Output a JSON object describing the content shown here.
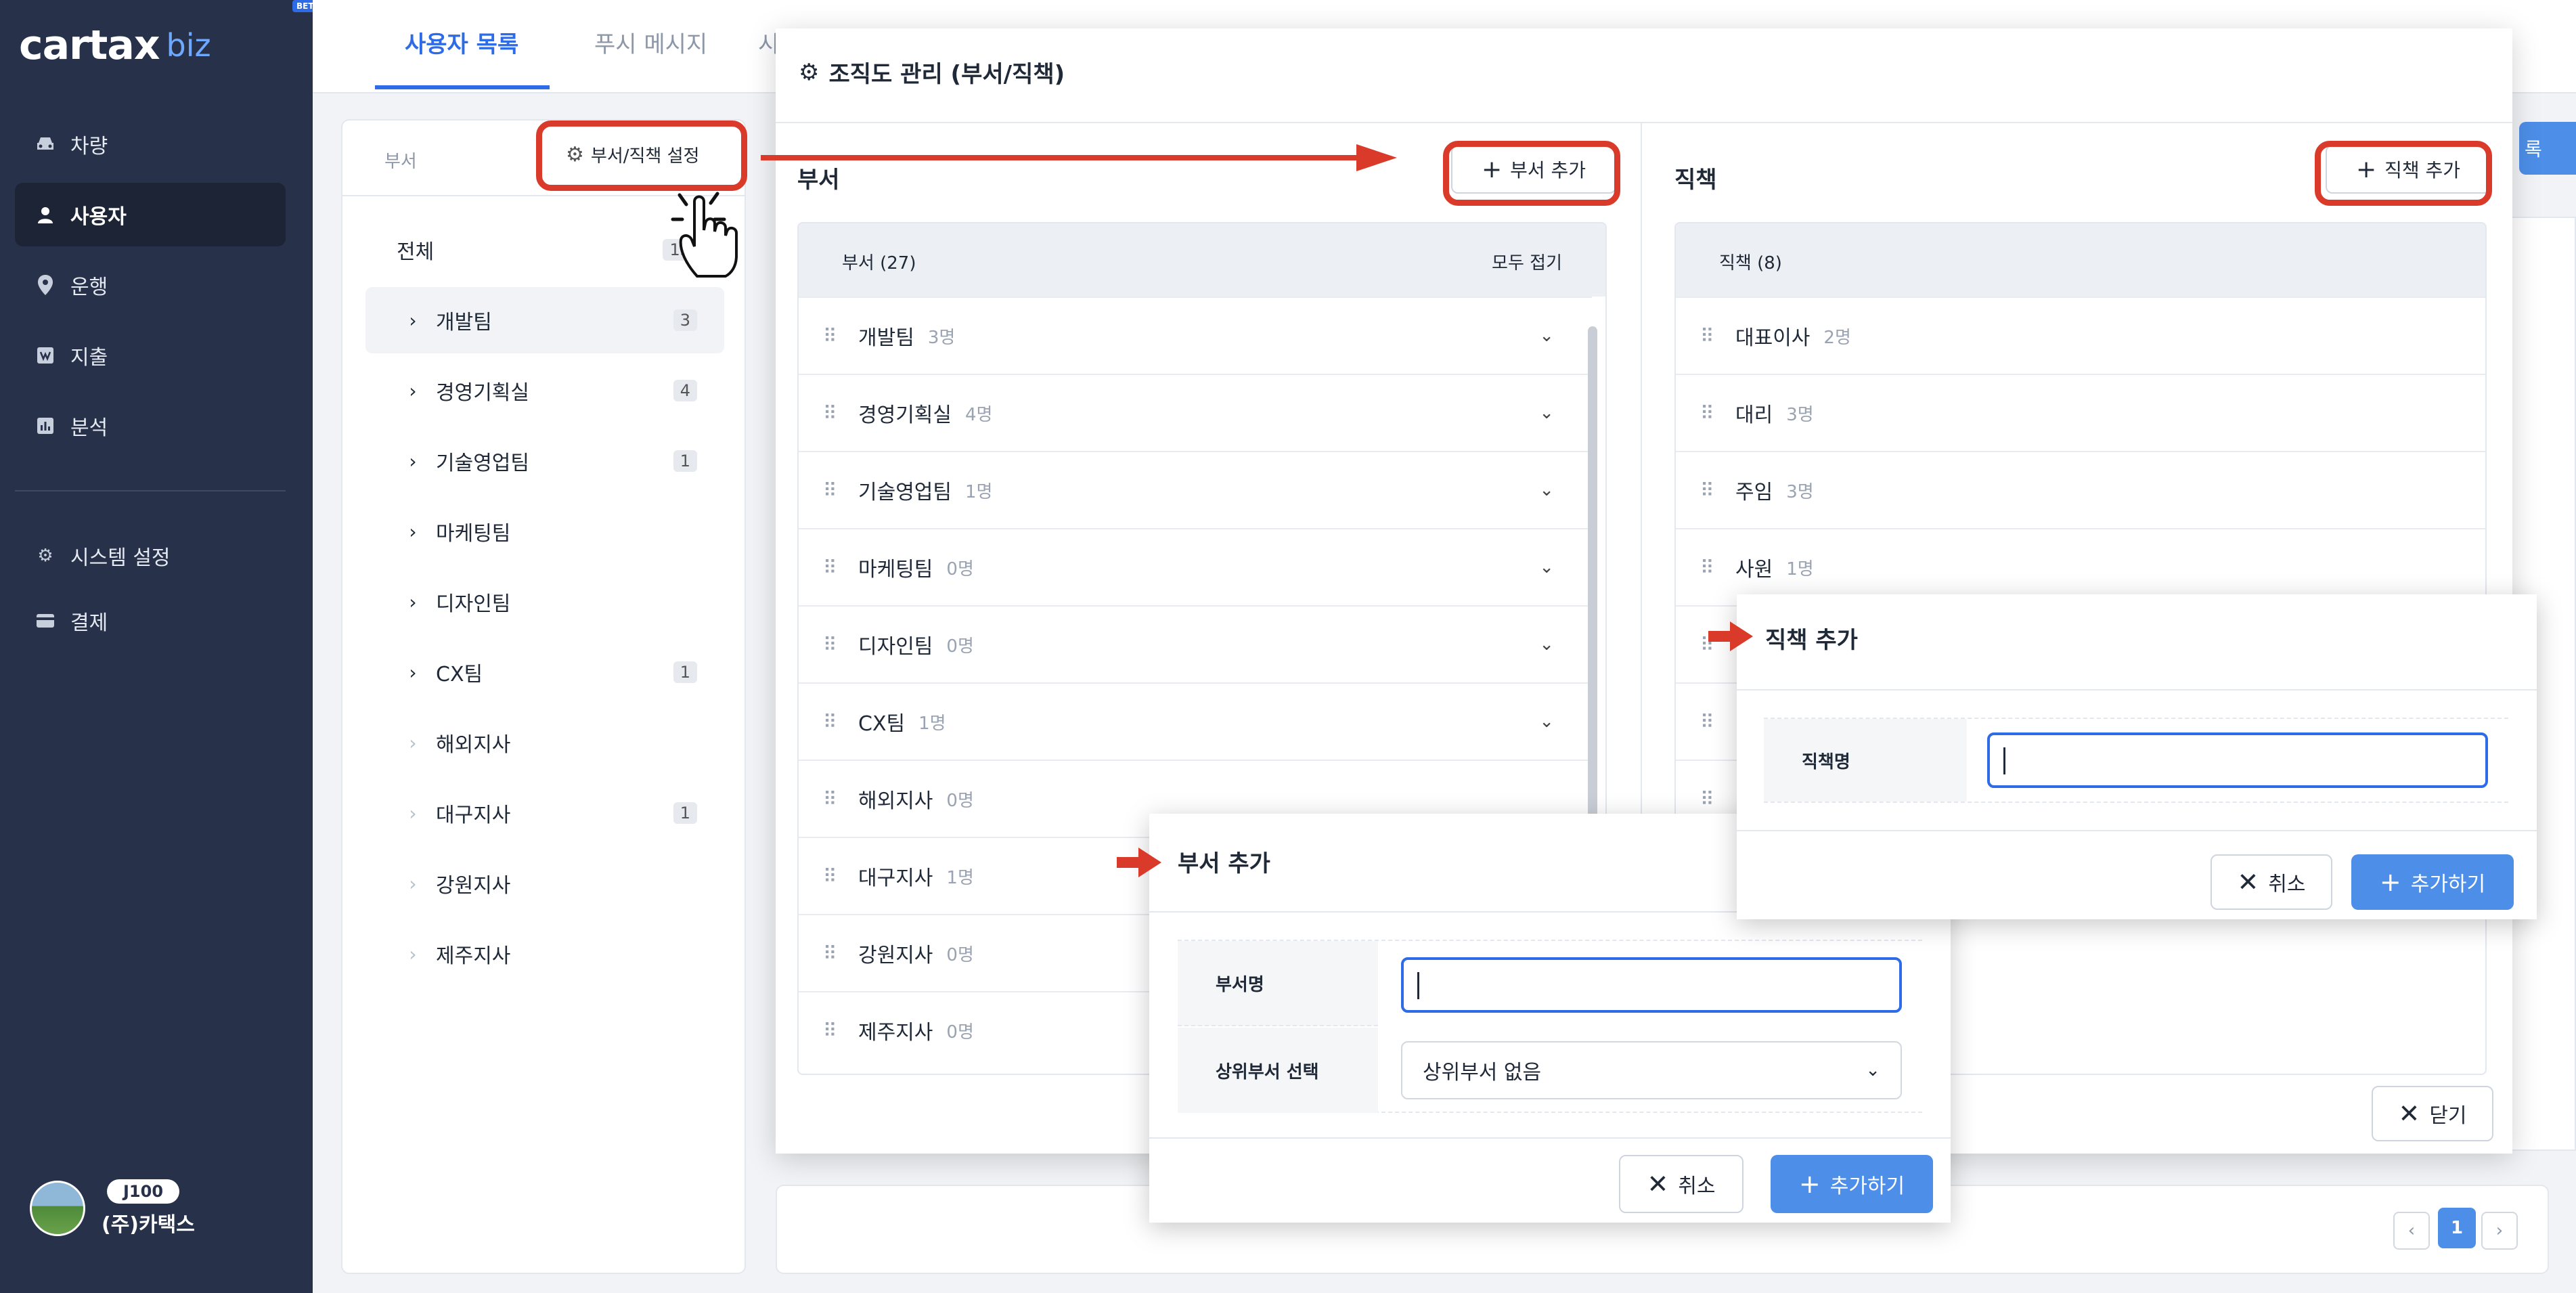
{
  "app": {
    "logo_text": "cartax",
    "logo_suffix": "biz",
    "beta_label": "BETA"
  },
  "sidebar": {
    "items": [
      {
        "label": "차량",
        "icon": "car-icon"
      },
      {
        "label": "사용자",
        "icon": "user-icon",
        "active": true
      },
      {
        "label": "운행",
        "icon": "location-pin-icon"
      },
      {
        "label": "지출",
        "icon": "receipt-icon"
      },
      {
        "label": "분석",
        "icon": "chart-icon"
      },
      {
        "label": "시스템 설정",
        "icon": "gear-icon"
      },
      {
        "label": "결제",
        "icon": "card-icon"
      }
    ],
    "profile": {
      "badge": "J100",
      "company": "(주)카택스"
    }
  },
  "tabs": [
    {
      "label": "사용자 목록",
      "active": true
    },
    {
      "label": "푸시 메시지"
    },
    {
      "label": "시"
    }
  ],
  "dept_panel": {
    "header_label": "부서",
    "settings_button": "부서/직책 설정",
    "rows": [
      {
        "name": "전체",
        "count": "13",
        "type": "all"
      },
      {
        "name": "개발팀",
        "count": "3",
        "expand": true,
        "selected": true
      },
      {
        "name": "경영기획실",
        "count": "4",
        "expand": true
      },
      {
        "name": "기술영업팀",
        "count": "1",
        "expand": true
      },
      {
        "name": "마케팅팀",
        "count": "",
        "expand": true
      },
      {
        "name": "디자인팀",
        "count": "",
        "expand": true
      },
      {
        "name": "CX팀",
        "count": "1",
        "expand": true
      },
      {
        "name": "해외지사",
        "count": "",
        "expand": false
      },
      {
        "name": "대구지사",
        "count": "1",
        "expand": false
      },
      {
        "name": "강원지사",
        "count": "",
        "expand": false
      },
      {
        "name": "제주지사",
        "count": "",
        "expand": false
      }
    ]
  },
  "register_button": "록",
  "org_modal": {
    "title": "조직도 관리 (부서/직책)",
    "dept_col": {
      "title": "부서",
      "add_button": "부서 추가",
      "list_title": "부서 (27)",
      "collapse_all": "모두 접기",
      "rows": [
        {
          "name": "개발팀",
          "count": "3명",
          "has_dropdown": true
        },
        {
          "name": "경영기획실",
          "count": "4명",
          "has_dropdown": true
        },
        {
          "name": "기술영업팀",
          "count": "1명",
          "has_dropdown": true
        },
        {
          "name": "마케팅팀",
          "count": "0명",
          "has_dropdown": true
        },
        {
          "name": "디자인팀",
          "count": "0명",
          "has_dropdown": true
        },
        {
          "name": "CX팀",
          "count": "1명",
          "has_dropdown": true
        },
        {
          "name": "해외지사",
          "count": "0명",
          "has_dropdown": false
        },
        {
          "name": "대구지사",
          "count": "1명",
          "has_dropdown": false
        },
        {
          "name": "강원지사",
          "count": "0명",
          "has_dropdown": false
        },
        {
          "name": "제주지사",
          "count": "0명",
          "has_dropdown": false
        }
      ]
    },
    "position_col": {
      "title": "직책",
      "add_button": "직책 추가",
      "list_title": "직책 (8)",
      "rows": [
        {
          "name": "대표이사",
          "count": "2명"
        },
        {
          "name": "대리",
          "count": "3명"
        },
        {
          "name": "주임",
          "count": "3명"
        },
        {
          "name": "사원",
          "count": "1명"
        }
      ]
    },
    "close_button": "닫기"
  },
  "add_dept_modal": {
    "title": "부서 추가",
    "name_label": "부서명",
    "name_value": "",
    "parent_label": "상위부서 선택",
    "parent_value": "상위부서 없음",
    "cancel_button": "취소",
    "submit_button": "추가하기"
  },
  "add_position_modal": {
    "title": "직책 추가",
    "name_label": "직책명",
    "name_value": "",
    "cancel_button": "취소",
    "submit_button": "추가하기"
  },
  "pagination": {
    "current": "1",
    "prev": "‹",
    "next": "›"
  },
  "colors": {
    "accent": "#2e6be6",
    "highlight": "#d93a2a",
    "sidebar": "#27324a",
    "primary_button": "#4d8ee8"
  }
}
